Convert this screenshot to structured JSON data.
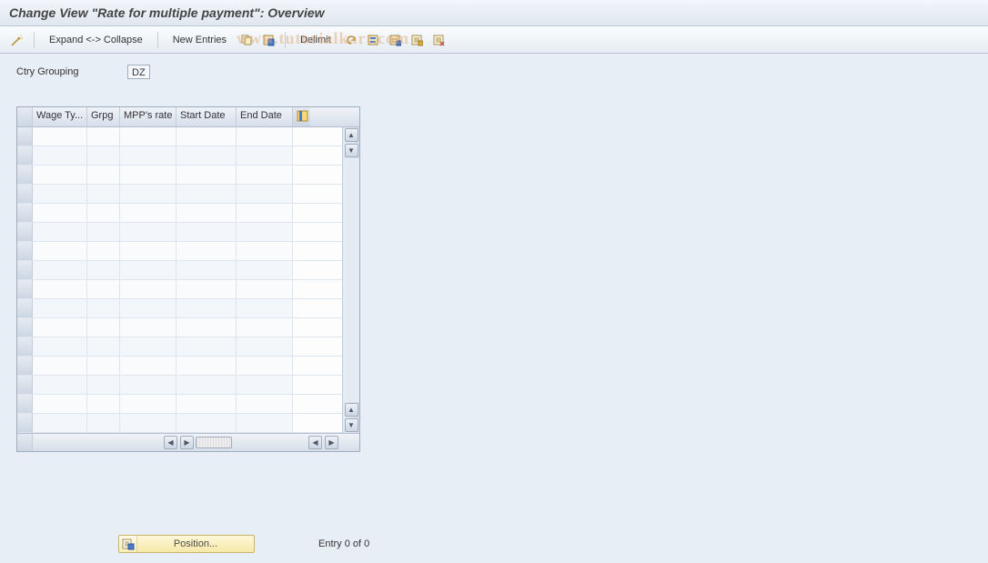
{
  "title": "Change View \"Rate for multiple payment\": Overview",
  "toolbar": {
    "expand_collapse": "Expand <-> Collapse",
    "new_entries": "New Entries",
    "delimit": "Delimit"
  },
  "form": {
    "ctry_grouping_label": "Ctry Grouping",
    "ctry_grouping_value": "DZ"
  },
  "grid": {
    "columns": {
      "wage_type": "Wage Ty...",
      "grpg": "Grpg",
      "mpp_rate": "MPP's rate",
      "start_date": "Start Date",
      "end_date": "End Date"
    },
    "row_count": 16
  },
  "footer": {
    "position_label": "Position...",
    "entry_text": "Entry 0 of 0"
  },
  "watermark": "www.tutorialkart.com"
}
